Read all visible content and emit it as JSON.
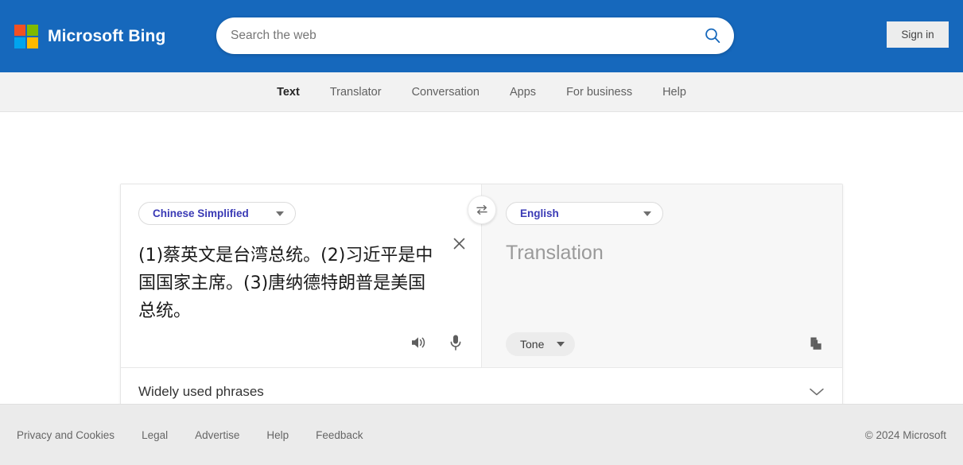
{
  "header": {
    "brand_name": "Microsoft Bing",
    "logo_icon": "microsoft-logo-icon",
    "search": {
      "placeholder": "Search the web",
      "value": "",
      "icon": "search-icon"
    },
    "signin_label": "Sign in",
    "background_color": "#1668bc"
  },
  "nav": {
    "items": [
      {
        "label": "Text",
        "active": true
      },
      {
        "label": "Translator",
        "active": false
      },
      {
        "label": "Conversation",
        "active": false
      },
      {
        "label": "Apps",
        "active": false
      },
      {
        "label": "For business",
        "active": false
      },
      {
        "label": "Help",
        "active": false
      }
    ]
  },
  "translator": {
    "source": {
      "language": "Chinese Simplified",
      "text": "(1)蔡英文是台湾总统。(2)习近平是中国国家主席。(3)唐纳德特朗普是美国总统。",
      "clear_icon": "close-icon",
      "speaker_icon": "speaker-icon",
      "microphone_icon": "microphone-icon",
      "language_color": "#3a3ab5"
    },
    "swap_icon": "swap-languages-icon",
    "target": {
      "language": "English",
      "placeholder": "Translation",
      "tone_label": "Tone",
      "copy_icon": "copy-icon",
      "language_color": "#3a3ab5"
    },
    "phrases": {
      "label": "Widely used phrases",
      "expand_icon": "chevron-down-icon"
    }
  },
  "footer": {
    "links": [
      "Privacy and Cookies",
      "Legal",
      "Advertise",
      "Help",
      "Feedback"
    ],
    "copyright": "© 2024 Microsoft"
  }
}
